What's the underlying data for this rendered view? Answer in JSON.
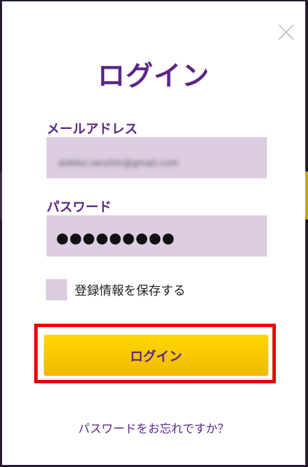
{
  "modal": {
    "title": "ログイン",
    "close_icon": "close-icon"
  },
  "email": {
    "label": "メールアドレス",
    "value": "dokkoi.ranshin@gmail.com"
  },
  "password": {
    "label": "パスワード",
    "masked_value": "●●●●●●●●●"
  },
  "remember": {
    "label": "登録情報を保存する",
    "checked": false
  },
  "login_button": {
    "label": "ログイン"
  },
  "forgot_password": {
    "label": "パスワードをお忘れですか？"
  },
  "colors": {
    "brand_purple": "#5b2686",
    "field_bg": "#dccde2",
    "button_yellow": "#ffd800",
    "highlight_red": "#e60000"
  }
}
